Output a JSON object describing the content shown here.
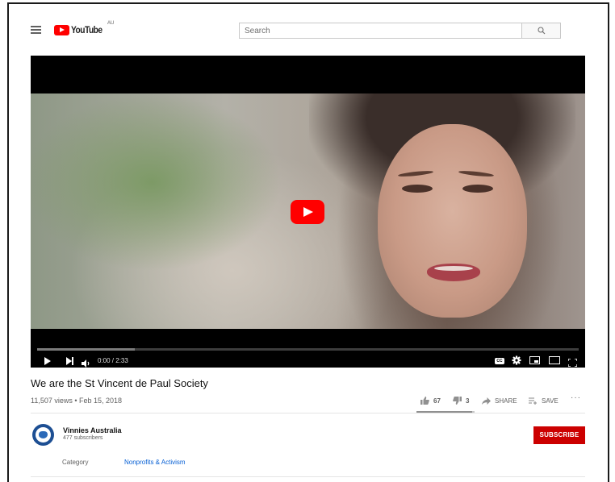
{
  "header": {
    "logo_text": "YouTube",
    "logo_region": "AU",
    "search_placeholder": "Search"
  },
  "player": {
    "time": "0:00 / 2:33",
    "buffered_fraction": 0.18,
    "cc_label": "CC"
  },
  "video": {
    "title": "We are the St Vincent de Paul Society",
    "meta": "11,507 views • Feb 15, 2018",
    "likes": "67",
    "dislikes": "3",
    "share_label": "SHARE",
    "save_label": "SAVE",
    "more_label": "···",
    "like_fraction": 0.96
  },
  "channel": {
    "name": "Vinnies Australia",
    "subscribers": "477 subscribers",
    "subscribe_label": "SUBSCRIBE"
  },
  "category": {
    "label": "Category",
    "value": "Nonprofits & Activism"
  },
  "colors": {
    "brand_red": "#ff0000",
    "subscribe_red": "#cc0000",
    "link_blue": "#065fd4"
  }
}
